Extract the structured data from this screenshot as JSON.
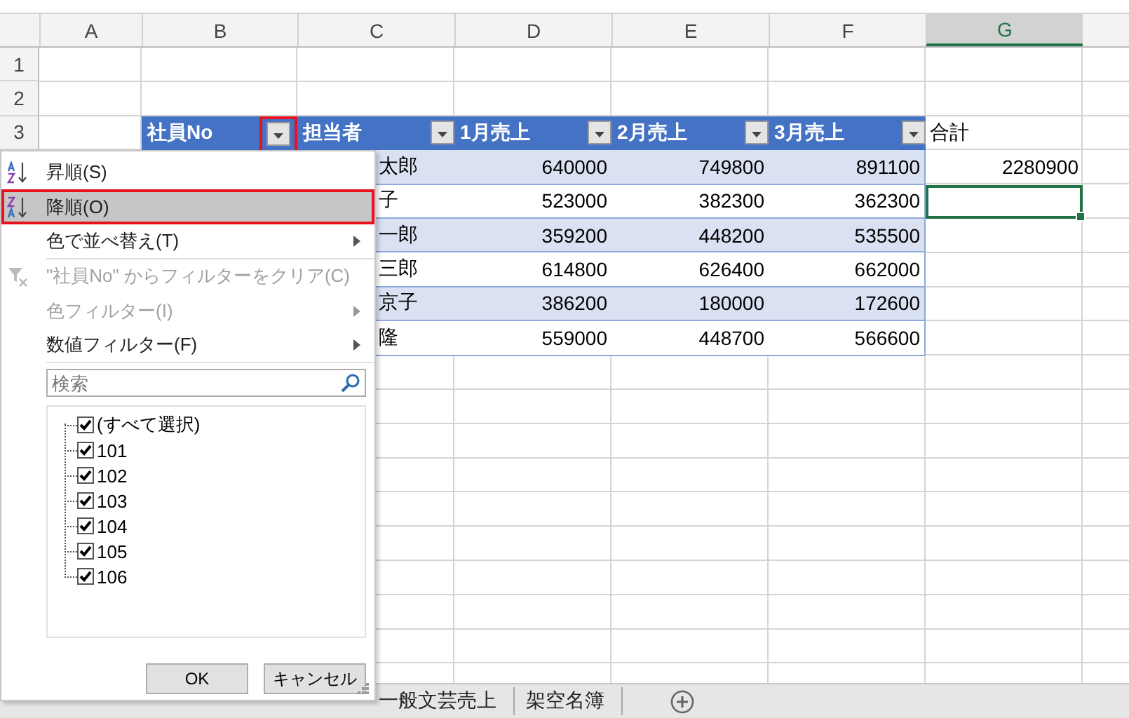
{
  "column_headers": [
    {
      "label": "A",
      "selected": false
    },
    {
      "label": "B",
      "selected": false
    },
    {
      "label": "C",
      "selected": false
    },
    {
      "label": "D",
      "selected": false
    },
    {
      "label": "E",
      "selected": false
    },
    {
      "label": "F",
      "selected": false
    },
    {
      "label": "G",
      "selected": true
    }
  ],
  "row_numbers": [
    "1",
    "2",
    "3"
  ],
  "table": {
    "columns": [
      {
        "label": "社員No",
        "highlighted": true
      },
      {
        "label": "担当者",
        "highlighted": false
      },
      {
        "label": "1月売上",
        "highlighted": false
      },
      {
        "label": "2月売上",
        "highlighted": false
      },
      {
        "label": "3月売上",
        "highlighted": false
      }
    ],
    "rows": [
      {
        "cells": [
          "太郎",
          "640000",
          "749800",
          "891100"
        ],
        "total": "2280900",
        "total_selected": false
      },
      {
        "cells": [
          "子",
          "523000",
          "382300",
          "362300"
        ],
        "total_selected": true
      },
      {
        "cells": [
          "一郎",
          "359200",
          "448200",
          "535500"
        ],
        "total_selected": false
      },
      {
        "cells": [
          "三郎",
          "614800",
          "626400",
          "662000"
        ],
        "total_selected": false
      },
      {
        "cells": [
          "京子",
          "386200",
          "180000",
          "172600"
        ],
        "total_selected": false
      },
      {
        "cells": [
          "隆",
          "559000",
          "448700",
          "566600"
        ],
        "total_selected": false
      }
    ]
  },
  "total_header": "合計",
  "filter_menu": {
    "items": [
      {
        "kind": "sort_asc",
        "label": "昇順(S)",
        "selected": false,
        "disabled": false,
        "submenu": false
      },
      {
        "kind": "sort_desc",
        "label": "降順(O)",
        "selected": true,
        "disabled": false,
        "submenu": false
      },
      {
        "kind": "item",
        "label": "色で並べ替え(T)",
        "selected": false,
        "disabled": false,
        "submenu": true
      },
      {
        "kind": "divider"
      },
      {
        "kind": "clear_filter",
        "label": "\"社員No\" からフィルターをクリア(C)",
        "selected": false,
        "disabled": true,
        "submenu": false
      },
      {
        "kind": "item",
        "label": "色フィルター(I)",
        "selected": false,
        "disabled": true,
        "submenu": true
      },
      {
        "kind": "item",
        "label": "数値フィルター(F)",
        "selected": false,
        "disabled": false,
        "submenu": true
      },
      {
        "kind": "divider"
      }
    ],
    "search": {
      "placeholder": "検索"
    },
    "values": [
      {
        "label": "(すべて選択)",
        "checked": true
      },
      {
        "label": "101",
        "checked": true
      },
      {
        "label": "102",
        "checked": true
      },
      {
        "label": "103",
        "checked": true
      },
      {
        "label": "104",
        "checked": true
      },
      {
        "label": "105",
        "checked": true
      },
      {
        "label": "106",
        "checked": true
      }
    ],
    "buttons": [
      "OK",
      "キャンセル"
    ]
  },
  "sheet_tabs": [
    "一般文芸売上",
    "架空名簿"
  ]
}
